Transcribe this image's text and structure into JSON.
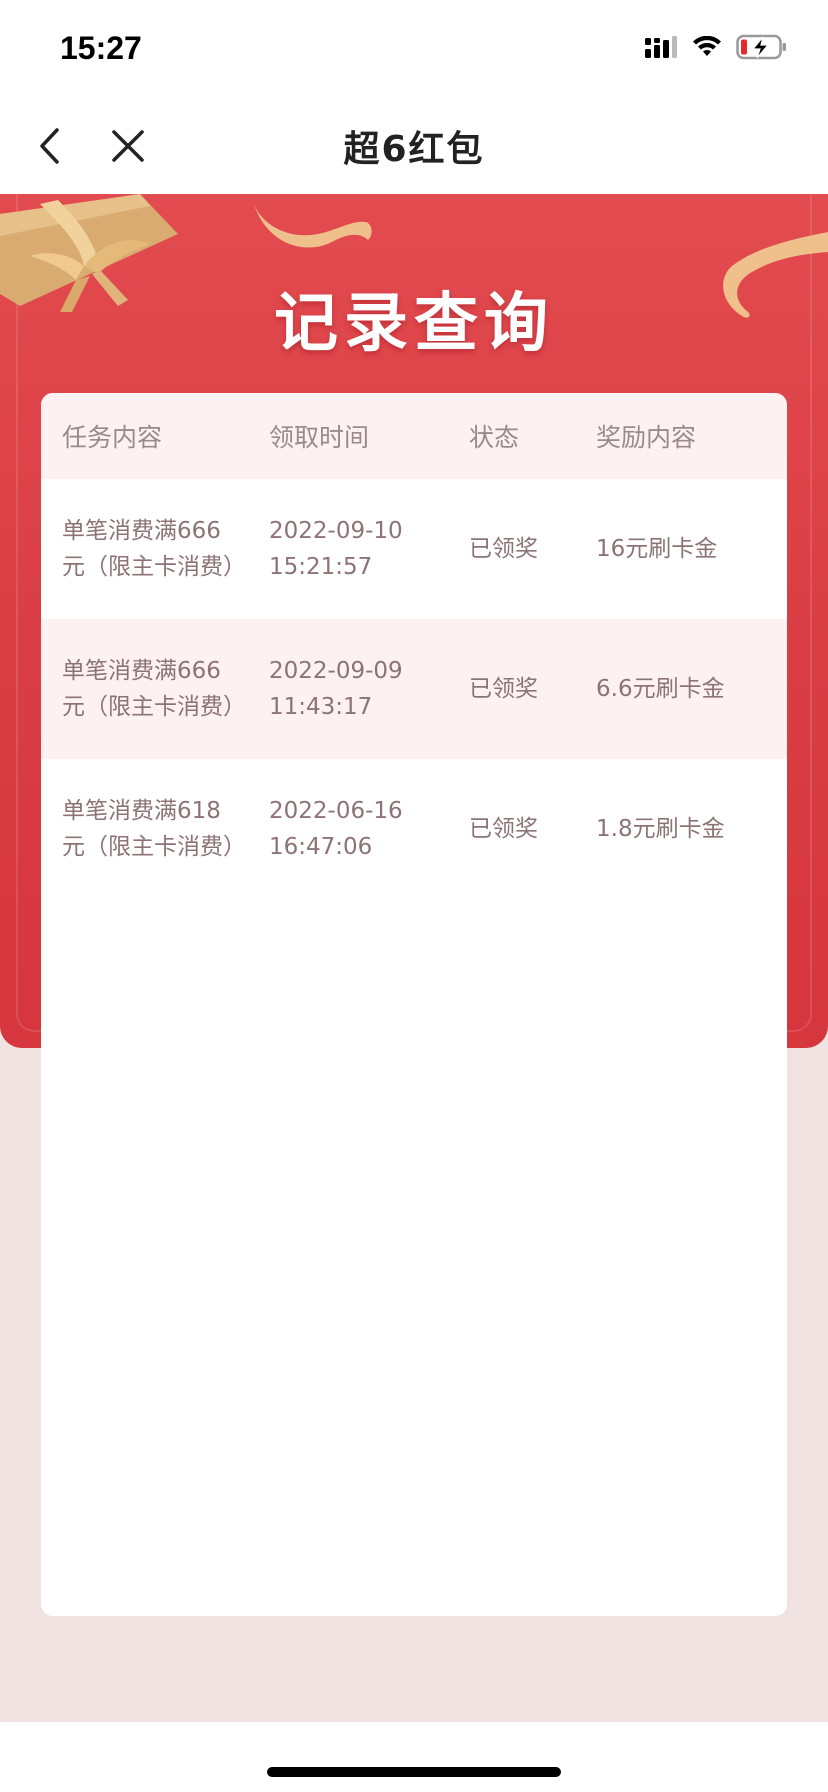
{
  "status": {
    "time": "15:27"
  },
  "nav": {
    "title": "超6红包"
  },
  "banner": {
    "title": "记录查询"
  },
  "table": {
    "headers": [
      "任务内容",
      "领取时间",
      "状态",
      "奖励内容"
    ],
    "rows": [
      {
        "task": "单笔消费满666元（限主卡消费）",
        "time_date": "2022-09-10",
        "time_clock": "15:21:57",
        "status": "已领奖",
        "reward": "16元刷卡金"
      },
      {
        "task": "单笔消费满666元（限主卡消费）",
        "time_date": "2022-09-09",
        "time_clock": "11:43:17",
        "status": "已领奖",
        "reward": "6.6元刷卡金"
      },
      {
        "task": "单笔消费满618元（限主卡消费）",
        "time_date": "2022-06-16",
        "time_clock": "16:47:06",
        "status": "已领奖",
        "reward": "1.8元刷卡金"
      }
    ]
  },
  "colors": {
    "banner_red": "#e24b4f",
    "row_tint": "#fdf1f1",
    "cell_text": "#8d7474",
    "page_bg": "#f2e3e3"
  },
  "icons": [
    "signal-icon",
    "wifi-icon",
    "battery-icon",
    "back-icon",
    "close-icon",
    "gift-icon",
    "ribbon-icon"
  ]
}
